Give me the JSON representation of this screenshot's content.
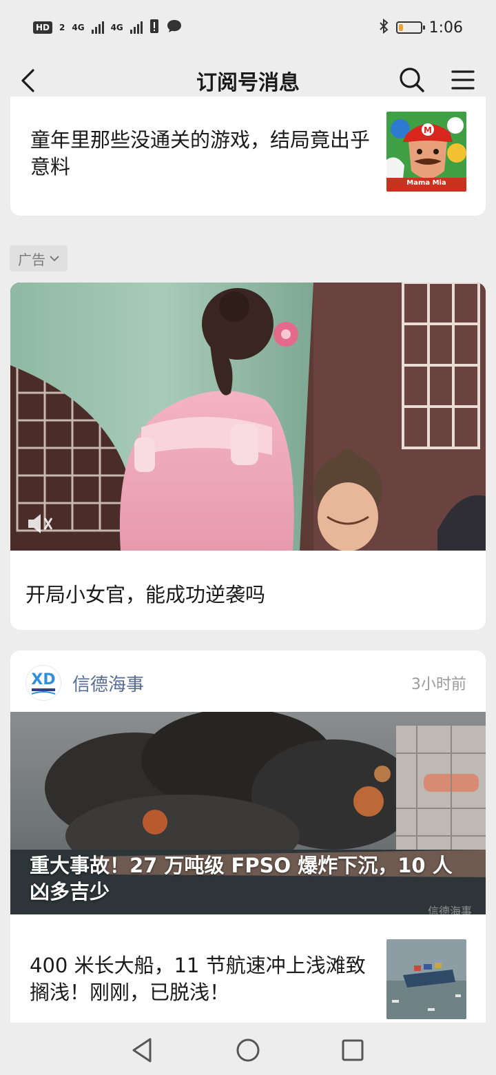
{
  "status_bar": {
    "hd": "HD",
    "sim": "2",
    "net1": "4G",
    "net2": "4G",
    "time": "1:06",
    "battery_level": 0.2
  },
  "header": {
    "title": "订阅号消息"
  },
  "articles": [
    {
      "title": "童年里那些没通关的游戏，结局竟出乎意料",
      "thumb_caption": "Mama Mia"
    }
  ],
  "ad": {
    "label": "广告",
    "title": "开局小女官，能成功逆袭吗"
  },
  "news_card": {
    "account_name": "信德海事",
    "time": "3小时前",
    "hero_title": "重大事故！27 万吨级 FPSO 爆炸下沉，10 人凶多吉少",
    "hero_watermark": "信德海事",
    "second_title": "400 米长大船，11 节航速冲上浅滩致搁浅！刚刚，已脱浅！"
  },
  "colors": {
    "background": "#ededed",
    "card": "#ffffff",
    "account_link": "#576b95",
    "meta": "#9a9a9a"
  }
}
